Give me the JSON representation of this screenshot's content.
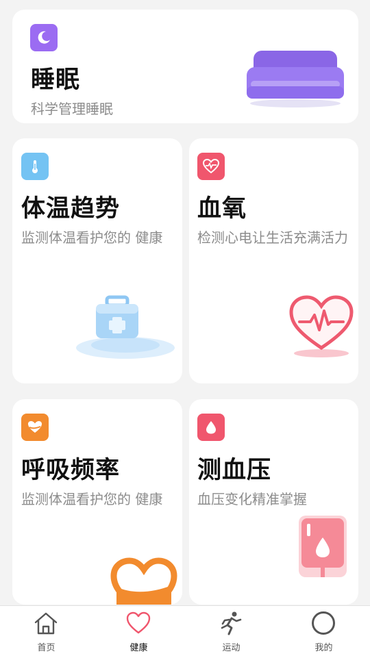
{
  "cards": {
    "sleep": {
      "title": "睡眠",
      "desc": "科学管理睡眠"
    },
    "temperature": {
      "title": "体温趋势",
      "desc": "监测体温看护您的 健康"
    },
    "blood_oxygen": {
      "title": "血氧",
      "desc": "检测心电让生活充满活力"
    },
    "respiration": {
      "title": "呼吸频率",
      "desc": "监测体温看护您的 健康"
    },
    "blood_pressure": {
      "title": "测血压",
      "desc": "血压变化精准掌握"
    }
  },
  "nav": {
    "items": [
      {
        "label": "首页",
        "icon": "home-icon"
      },
      {
        "label": "健康",
        "icon": "heart-icon",
        "active": true
      },
      {
        "label": "运动",
        "icon": "running-icon"
      },
      {
        "label": "我的",
        "icon": "profile-icon"
      }
    ]
  },
  "colors": {
    "sleep_accent": "#9b6cf2",
    "temperature_accent": "#74c3f3",
    "blood_oxygen_accent": "#f0566d",
    "respiration_accent": "#f28b2e",
    "blood_pressure_accent": "#f0566d",
    "nav_active": "#f0566d"
  }
}
